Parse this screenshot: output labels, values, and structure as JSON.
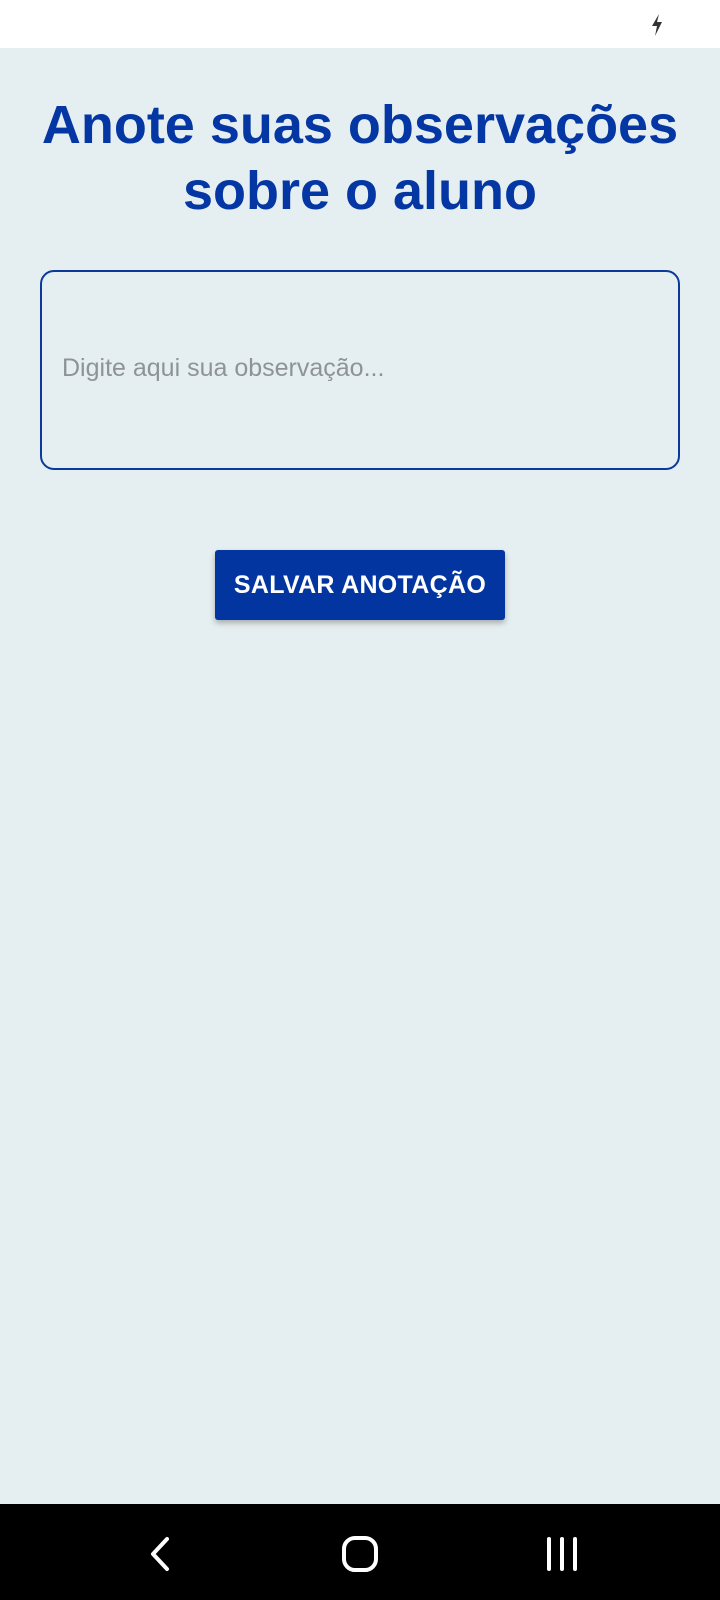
{
  "status_bar": {
    "icons": [
      "flash-icon"
    ]
  },
  "page": {
    "title": "Anote suas observações sobre o aluno"
  },
  "note_input": {
    "placeholder": "Digite aqui sua observação...",
    "value": ""
  },
  "save_button": {
    "label": "SALVAR ANOTAÇÃO"
  },
  "nav_bar": {
    "icons": [
      "back-icon",
      "home-icon",
      "recent-apps-icon"
    ]
  },
  "colors": {
    "background": "#e5eef0",
    "accent": "#0437a3",
    "button": "#0335a1",
    "placeholder": "#8e9495",
    "nav_bar": "#000000"
  }
}
